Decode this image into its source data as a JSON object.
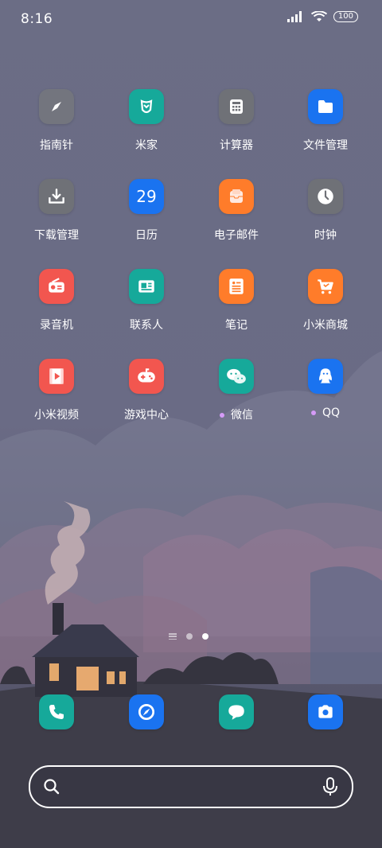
{
  "status_bar": {
    "time": "8:16",
    "battery": "100"
  },
  "apps": [
    {
      "label": "指南针",
      "icon": "compass-icon",
      "color": "#73757e",
      "dot": false
    },
    {
      "label": "米家",
      "icon": "mijia-icon",
      "color": "#16a99a",
      "dot": false
    },
    {
      "label": "计算器",
      "icon": "calculator-icon",
      "color": "#6f7177",
      "dot": false
    },
    {
      "label": "文件管理",
      "icon": "folder-icon",
      "color": "#1a73f0",
      "dot": false
    },
    {
      "label": "下载管理",
      "icon": "download-icon",
      "color": "#6f7177",
      "dot": false
    },
    {
      "label": "日历",
      "icon": "calendar-icon",
      "color": "#1a73f0",
      "dot": false,
      "text": "29"
    },
    {
      "label": "电子邮件",
      "icon": "mail-icon",
      "color": "#ff7c2a",
      "dot": false
    },
    {
      "label": "时钟",
      "icon": "clock-icon",
      "color": "#6f7177",
      "dot": false
    },
    {
      "label": "录音机",
      "icon": "recorder-icon",
      "color": "#f2564f",
      "dot": false
    },
    {
      "label": "联系人",
      "icon": "contacts-icon",
      "color": "#16a99a",
      "dot": false
    },
    {
      "label": "笔记",
      "icon": "notes-icon",
      "color": "#ff7c2a",
      "dot": false
    },
    {
      "label": "小米商城",
      "icon": "shopping-cart-icon",
      "color": "#ff7c2a",
      "dot": false
    },
    {
      "label": "小米视频",
      "icon": "video-icon",
      "color": "#f2564f",
      "dot": false
    },
    {
      "label": "游戏中心",
      "icon": "gamepad-icon",
      "color": "#f2564f",
      "dot": false
    },
    {
      "label": "微信",
      "icon": "wechat-icon",
      "color": "#16a99a",
      "dot": true
    },
    {
      "label": "QQ",
      "icon": "qq-icon",
      "color": "#1a73f0",
      "dot": true
    }
  ],
  "dock": [
    {
      "icon": "phone-icon",
      "color": "#16a99a"
    },
    {
      "icon": "browser-icon",
      "color": "#1a73f0"
    },
    {
      "icon": "messages-icon",
      "color": "#16a99a"
    },
    {
      "icon": "camera-icon",
      "color": "#1a73f0"
    }
  ]
}
